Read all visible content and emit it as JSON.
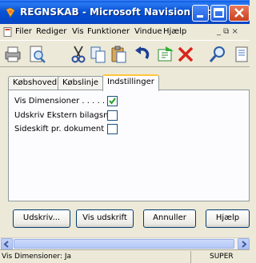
{
  "window": {
    "title": "REGNSKAB - Microsoft Navision Attain - ..."
  },
  "menu": {
    "items": [
      "Filer",
      "Rediger",
      "Vis",
      "Funktioner",
      "Vindue",
      "Hjælp"
    ],
    "right_controls": "_ ⧉ ×"
  },
  "toolbar": {
    "icons": [
      "print-icon",
      "print-preview-icon",
      "cut-icon",
      "copy-icon",
      "paste-icon",
      "undo-icon",
      "new-record-icon",
      "delete-icon",
      "find-icon",
      "filter-icon"
    ]
  },
  "tabs": [
    {
      "label": "Købshoved",
      "active": false
    },
    {
      "label": "Købslinje",
      "active": false
    },
    {
      "label": "Indstillinger",
      "active": true
    }
  ],
  "options": [
    {
      "label": "Vis Dimensioner . . . . . .",
      "checked": true
    },
    {
      "label": "Udskriv Ekstern bilagsn...",
      "checked": false
    },
    {
      "label": "Sideskift pr. dokument . .",
      "checked": false
    }
  ],
  "buttons": {
    "print": "Udskriv...",
    "preview": "Vis udskrift",
    "cancel": "Annuller",
    "help": "Hjælp"
  },
  "status": {
    "left": "Vis Dimensioner: Ja",
    "user": "SUPER"
  },
  "colors": {
    "titlebar": "#0653d6",
    "close_button": "#c8401f",
    "active_tab_accent": "#ffc83c",
    "checkmark": "#21a121"
  }
}
